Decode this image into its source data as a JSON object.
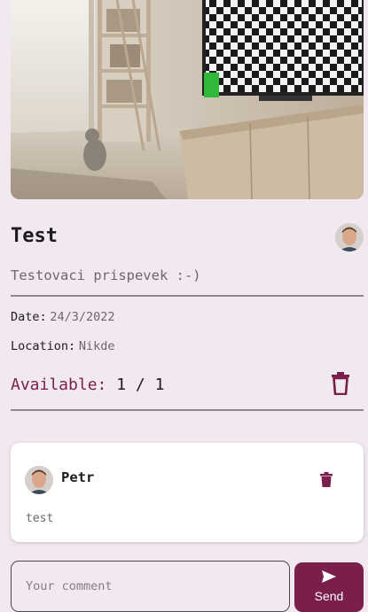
{
  "post": {
    "title": "Test",
    "description": "Testovaci prispevek :-)",
    "date_label": "Date:",
    "date_value": "24/3/2022",
    "location_label": "Location:",
    "location_value": "Nikde",
    "available_label": "Available:",
    "available_value": "1 / 1"
  },
  "comments": [
    {
      "author": "Petr",
      "text": "test"
    }
  ],
  "composer": {
    "placeholder": "Your comment",
    "send_label": "Send"
  },
  "icons": {
    "delete_post": "trash-outline-icon",
    "delete_comment": "trash-filled-icon",
    "send": "send-arrow-icon"
  },
  "colors": {
    "background": "#f1e9ef",
    "accent": "#7a1e4c",
    "card": "#ffffff"
  }
}
